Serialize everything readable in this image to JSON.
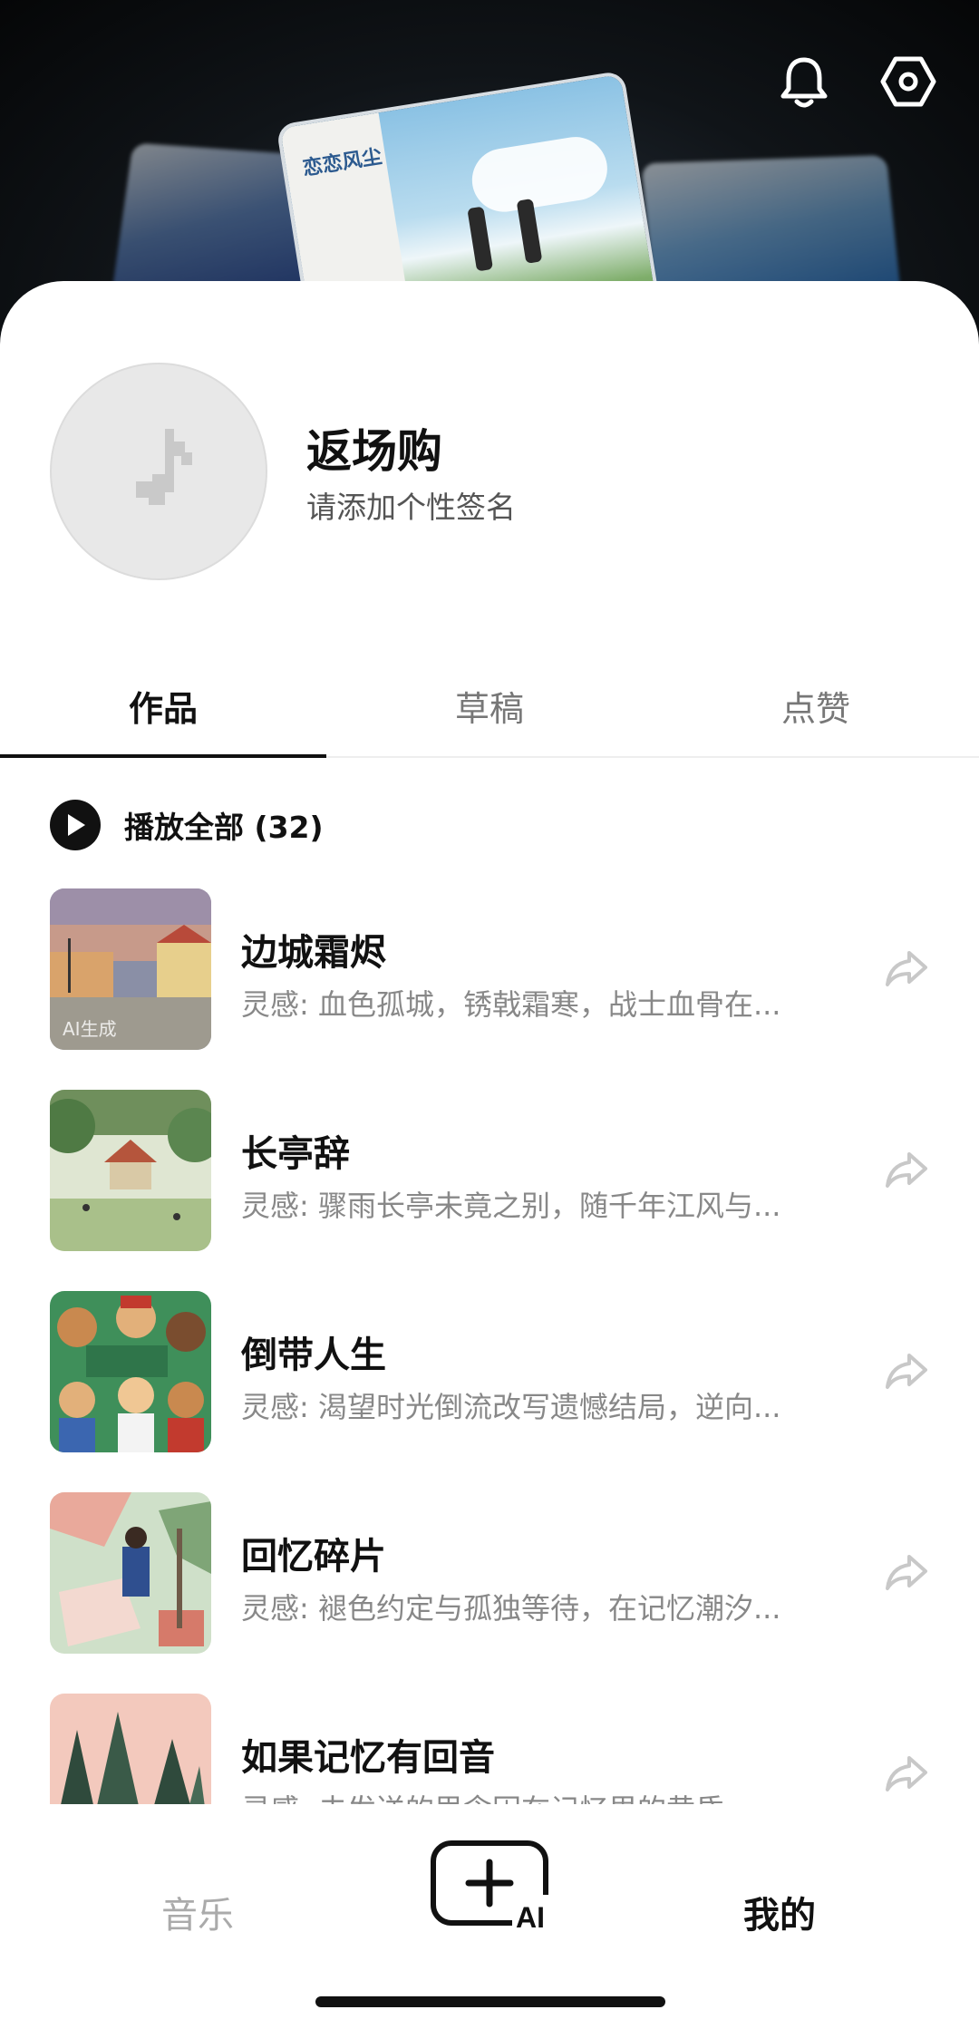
{
  "header": {
    "featured_card_text": "恋恋风尘",
    "bell_icon": "bell-icon",
    "settings_icon": "settings-hexagon-icon"
  },
  "profile": {
    "username": "返场购",
    "signature": "请添加个性签名",
    "avatar_icon": "music-note-icon"
  },
  "tabs": [
    {
      "label": "作品",
      "active": true
    },
    {
      "label": "草稿",
      "active": false
    },
    {
      "label": "点赞",
      "active": false
    }
  ],
  "play_all": {
    "label": "播放全部 (32)"
  },
  "songs": [
    {
      "title": "边城霜烬",
      "desc": "灵感: 血色孤城，锈戟霜寒，战士血骨在...",
      "cover_badge": "AI生成"
    },
    {
      "title": "长亭辞",
      "desc": "灵感: 骤雨长亭未竟之别，随千年江风与..."
    },
    {
      "title": "倒带人生",
      "desc": "灵感: 渴望时光倒流改写遗憾结局，逆向..."
    },
    {
      "title": "回忆碎片",
      "desc": "灵感: 褪色约定与孤独等待，在记忆潮汐..."
    },
    {
      "title": "如果记忆有回音",
      "desc": "灵感: 未发送的思念困在记忆里的黄昏"
    }
  ],
  "nav": {
    "music": "音乐",
    "mine": "我的",
    "create_ai_label": "AI"
  },
  "colors": {
    "accent": "#111111",
    "muted": "#888888",
    "inactive_nav": "#aaaaaa"
  }
}
